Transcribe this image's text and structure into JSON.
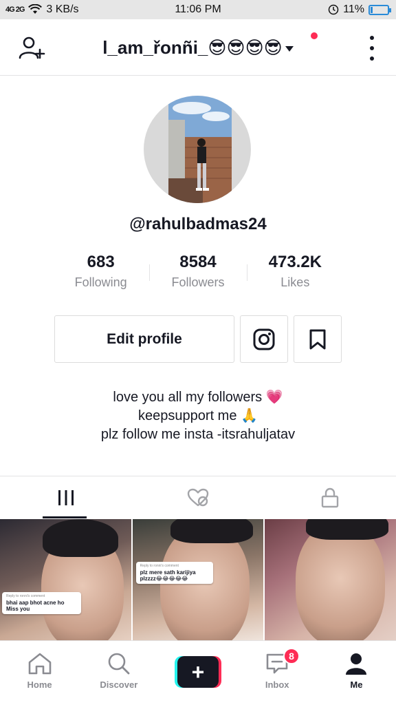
{
  "status_bar": {
    "signal": "4G 2G",
    "network_speed": "3 KB/s",
    "time": "11:06 PM",
    "battery": "11%",
    "battery_level": 0.11
  },
  "header": {
    "username": "l_am_řonñi_😎😎😎😎",
    "add_user_icon": "person-add-icon",
    "more_icon": "more-vertical-icon",
    "notification_dot_color": "#fe2c55"
  },
  "profile": {
    "handle": "@rahulbadmas24",
    "stats": [
      {
        "value": "683",
        "label": "Following"
      },
      {
        "value": "8584",
        "label": "Followers"
      },
      {
        "value": "473.2K",
        "label": "Likes"
      }
    ],
    "edit_button": "Edit profile",
    "instagram_icon": "instagram-icon",
    "bookmark_icon": "bookmark-icon",
    "bio": [
      "love you all my followers 💗",
      "keepsupport me 🙏",
      "plz follow me insta -itsrahuljatav"
    ]
  },
  "tabs": [
    {
      "icon": "videos-grid-icon",
      "active": true
    },
    {
      "icon": "liked-videos-icon",
      "active": false
    },
    {
      "icon": "private-lock-icon",
      "active": false
    }
  ],
  "videos": [
    {
      "comment_reply": "Reply to ronni's comment",
      "comment_text": "bhai aap bhot acne ho Miss you"
    },
    {
      "comment_reply": "Reply to ronni's comment",
      "comment_text": "plz mere sath karijiya plzzzz😂😂😂😂😂"
    },
    {
      "comment_reply": "",
      "comment_text": ""
    }
  ],
  "bottom_nav": [
    {
      "label": "Home",
      "icon": "home-icon"
    },
    {
      "label": "Discover",
      "icon": "search-icon"
    },
    {
      "label": "",
      "icon": "plus-icon"
    },
    {
      "label": "Inbox",
      "icon": "inbox-icon"
    },
    {
      "label": "Me",
      "icon": "profile-icon"
    }
  ],
  "inbox_badge": "8",
  "colors": {
    "accent_red": "#fe2c55",
    "accent_cyan": "#25f4ee",
    "text_primary": "#161823",
    "text_secondary": "#8a8b91"
  }
}
